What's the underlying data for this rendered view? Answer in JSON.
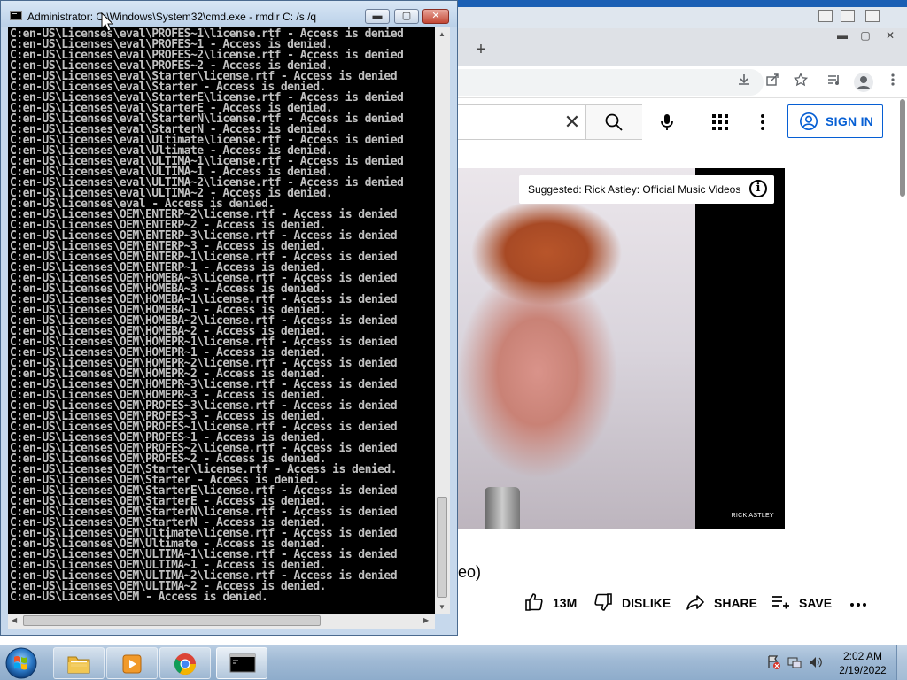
{
  "cmd": {
    "title": "Administrator: C:\\Windows\\System32\\cmd.exe - rmdir  C: /s /q",
    "buttons": {
      "minimize": "▬",
      "maximize": "▢",
      "close": "✕"
    },
    "lines": [
      "C:en-US\\Licenses\\eval\\PROFES~1\\license.rtf - Access is denied",
      "C:en-US\\Licenses\\eval\\PROFES~1 - Access is denied.",
      "C:en-US\\Licenses\\eval\\PROFES~2\\license.rtf - Access is denied",
      "C:en-US\\Licenses\\eval\\PROFES~2 - Access is denied.",
      "C:en-US\\Licenses\\eval\\Starter\\license.rtf - Access is denied",
      "C:en-US\\Licenses\\eval\\Starter - Access is denied.",
      "C:en-US\\Licenses\\eval\\StarterE\\license.rtf - Access is denied",
      "C:en-US\\Licenses\\eval\\StarterE - Access is denied.",
      "C:en-US\\Licenses\\eval\\StarterN\\license.rtf - Access is denied",
      "C:en-US\\Licenses\\eval\\StarterN - Access is denied.",
      "C:en-US\\Licenses\\eval\\Ultimate\\license.rtf - Access is denied",
      "C:en-US\\Licenses\\eval\\Ultimate - Access is denied.",
      "C:en-US\\Licenses\\eval\\ULTIMA~1\\license.rtf - Access is denied",
      "C:en-US\\Licenses\\eval\\ULTIMA~1 - Access is denied.",
      "C:en-US\\Licenses\\eval\\ULTIMA~2\\license.rtf - Access is denied",
      "C:en-US\\Licenses\\eval\\ULTIMA~2 - Access is denied.",
      "C:en-US\\Licenses\\eval - Access is denied.",
      "C:en-US\\Licenses\\OEM\\ENTERP~2\\license.rtf - Access is denied",
      "C:en-US\\Licenses\\OEM\\ENTERP~2 - Access is denied.",
      "C:en-US\\Licenses\\OEM\\ENTERP~3\\license.rtf - Access is denied",
      "C:en-US\\Licenses\\OEM\\ENTERP~3 - Access is denied.",
      "C:en-US\\Licenses\\OEM\\ENTERP~1\\license.rtf - Access is denied",
      "C:en-US\\Licenses\\OEM\\ENTERP~1 - Access is denied.",
      "C:en-US\\Licenses\\OEM\\HOMEBA~3\\license.rtf - Access is denied",
      "C:en-US\\Licenses\\OEM\\HOMEBA~3 - Access is denied.",
      "C:en-US\\Licenses\\OEM\\HOMEBA~1\\license.rtf - Access is denied",
      "C:en-US\\Licenses\\OEM\\HOMEBA~1 - Access is denied.",
      "C:en-US\\Licenses\\OEM\\HOMEBA~2\\license.rtf - Access is denied",
      "C:en-US\\Licenses\\OEM\\HOMEBA~2 - Access is denied.",
      "C:en-US\\Licenses\\OEM\\HOMEPR~1\\license.rtf - Access is denied",
      "C:en-US\\Licenses\\OEM\\HOMEPR~1 - Access is denied.",
      "C:en-US\\Licenses\\OEM\\HOMEPR~2\\license.rtf - Access is denied",
      "C:en-US\\Licenses\\OEM\\HOMEPR~2 - Access is denied.",
      "C:en-US\\Licenses\\OEM\\HOMEPR~3\\license.rtf - Access is denied",
      "C:en-US\\Licenses\\OEM\\HOMEPR~3 - Access is denied.",
      "C:en-US\\Licenses\\OEM\\PROFES~3\\license.rtf - Access is denied",
      "C:en-US\\Licenses\\OEM\\PROFES~3 - Access is denied.",
      "C:en-US\\Licenses\\OEM\\PROFES~1\\license.rtf - Access is denied",
      "C:en-US\\Licenses\\OEM\\PROFES~1 - Access is denied.",
      "C:en-US\\Licenses\\OEM\\PROFES~2\\license.rtf - Access is denied",
      "C:en-US\\Licenses\\OEM\\PROFES~2 - Access is denied.",
      "C:en-US\\Licenses\\OEM\\Starter\\license.rtf - Access is denied.",
      "C:en-US\\Licenses\\OEM\\Starter - Access is denied.",
      "C:en-US\\Licenses\\OEM\\StarterE\\license.rtf - Access is denied",
      "C:en-US\\Licenses\\OEM\\StarterE - Access is denied.",
      "C:en-US\\Licenses\\OEM\\StarterN\\license.rtf - Access is denied",
      "C:en-US\\Licenses\\OEM\\StarterN - Access is denied.",
      "C:en-US\\Licenses\\OEM\\Ultimate\\license.rtf - Access is denied",
      "C:en-US\\Licenses\\OEM\\Ultimate - Access is denied.",
      "C:en-US\\Licenses\\OEM\\ULTIMA~1\\license.rtf - Access is denied",
      "C:en-US\\Licenses\\OEM\\ULTIMA~1 - Access is denied.",
      "C:en-US\\Licenses\\OEM\\ULTIMA~2\\license.rtf - Access is denied",
      "C:en-US\\Licenses\\OEM\\ULTIMA~2 - Access is denied.",
      "C:en-US\\Licenses\\OEM - Access is denied."
    ]
  },
  "browser": {
    "new_tab": "+",
    "window_buttons": [
      "▬",
      "▢",
      "✕"
    ]
  },
  "youtube": {
    "search_clear": "✕",
    "sign_in": "SIGN IN",
    "suggested": "Suggested: Rick Astley: Official Music Videos",
    "info": "i",
    "watermark": "RICK ASTLEY",
    "title_tail": "eo)",
    "actions": {
      "like": "13M",
      "dislike": "DISLIKE",
      "share": "SHARE",
      "save": "SAVE",
      "more": "..."
    },
    "accent_color": "#065fd4"
  },
  "taskbar": {
    "time": "2:02 AM",
    "date": "2/19/2022",
    "pinned": [
      "windows-explorer",
      "media-player",
      "chrome",
      "command-prompt"
    ]
  }
}
